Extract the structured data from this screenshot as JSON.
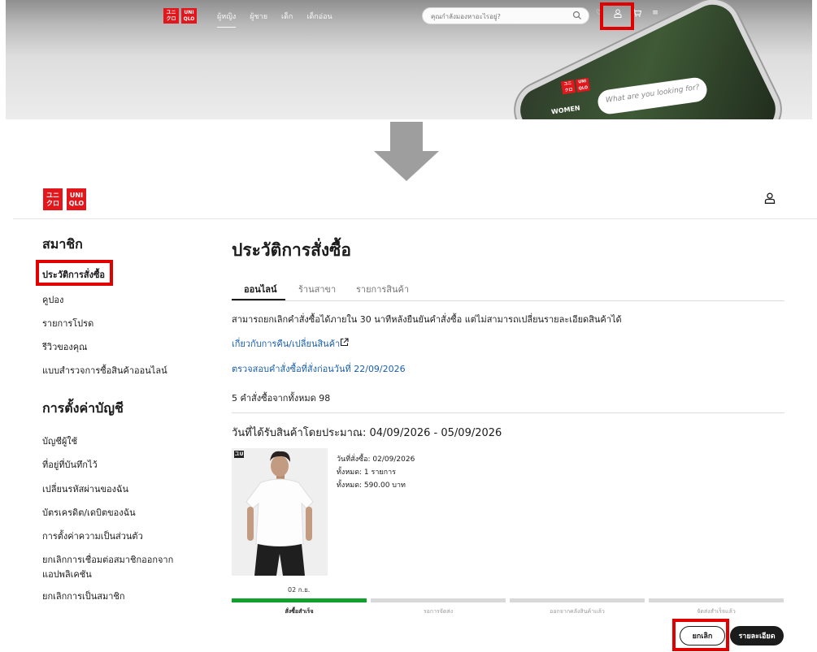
{
  "banner": {
    "logo": {
      "left_top": "ユニ",
      "left_bottom": "クロ",
      "right_top": "UNI",
      "right_bottom": "QLO"
    },
    "nav": [
      "ผู้หญิง",
      "ผู้ชาย",
      "เด็ก",
      "เด็กอ่อน"
    ],
    "search_placeholder": "คุณกำลังมองหาอะไรอยู่?",
    "icons": [
      "heart-icon",
      "account-icon",
      "cart-icon",
      "menu-icon"
    ],
    "phone_search_placeholder": "What are you looking for?",
    "phone_nav_label": "WOMEN"
  },
  "header": {
    "logo": {
      "left_top": "ユニ",
      "left_bottom": "クロ",
      "right_top": "UNI",
      "right_bottom": "QLO"
    }
  },
  "sidebar": {
    "member_heading": "สมาชิก",
    "member_items": [
      "ประวัติการสั่งซื้อ",
      "คูปอง",
      "รายการโปรด",
      "รีวิวของคุณ",
      "แบบสำรวจการซื้อสินค้าออนไลน์"
    ],
    "settings_heading": "การตั้งค่าบัญชี",
    "settings_items": [
      "บัญชีผู้ใช้",
      "ที่อยู่ที่บันทึกไว้",
      "เปลี่ยนรหัสผ่านของฉัน",
      "บัตรเครดิต/เดบิตของฉัน",
      "การตั้งค่าความเป็นส่วนตัว",
      "ยกเลิกการเชื่อมต่อสมาชิกออกจาก",
      "แอปพลิเคชัน",
      "ยกเลิกการเป็นสมาชิก"
    ]
  },
  "main": {
    "title": "ประวัติการสั่งซื้อ",
    "tabs": [
      "ออนไลน์",
      "ร้านสาขา",
      "รายการสินค้า"
    ],
    "notice": "สามารถยกเลิกคำสั่งซื้อได้ภายใน 30 นาทีหลังยืนยันคำสั่งซื้อ แต่ไม่สามารถเปลี่ยนรายละเอียดสินค้าได้",
    "return_link": "เกี่ยวกับการคืน/เปลี่ยนสินค้า",
    "older_orders_link": "ตรวจสอบคำสั่งซื้อที่สั่งก่อนวันที่ 22/09/2026",
    "order_count": "5 คำสั่งซื้อจากทั้งหมด 98",
    "order": {
      "delivery_estimate": "วันที่ได้รับสินค้าโดยประมาณ: 04/09/2026 - 05/09/2026",
      "product_tag": "ユU",
      "order_date": "วันที่สั่งซื้อ: 02/09/2026",
      "item_count": "ทั้งหมด: 1 รายการ",
      "total": "ทั้งหมด: 590.00 บาท",
      "status_date": "02 ก.ย.",
      "steps": [
        "สั่งซื้อสำเร็จ",
        "รอการจัดส่ง",
        "ออกจากคลังสินค้าแล้ว",
        "จัดส่งสำเร็จแล้ว"
      ],
      "progress_completed_steps": 1,
      "cancel_label": "ยกเลิก",
      "details_label": "รายละเอียด"
    }
  },
  "colors": {
    "brand_red": "#e2161b",
    "highlight_red": "#e10000",
    "progress_green": "#12a02d",
    "link_blue": "#1a5fab"
  }
}
